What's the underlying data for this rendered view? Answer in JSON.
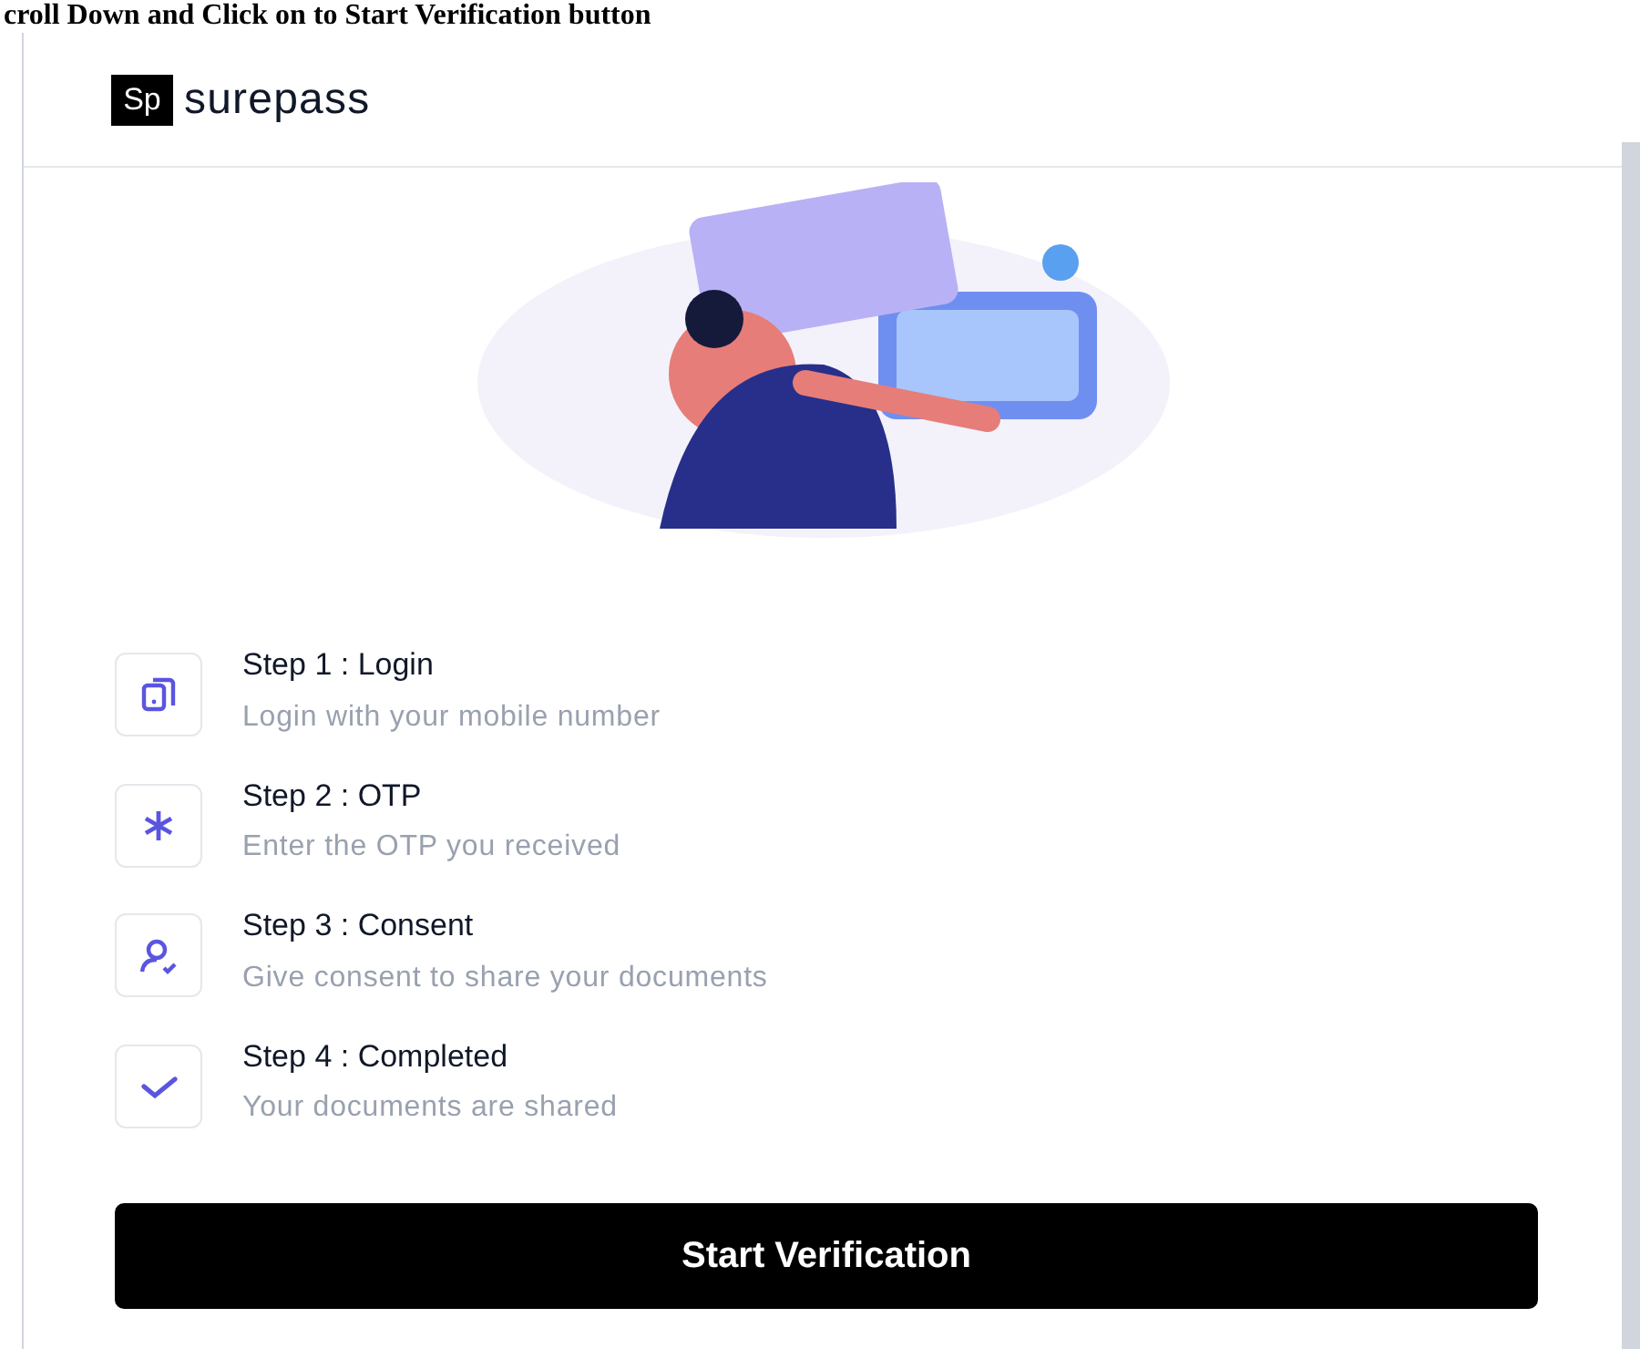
{
  "caption": "croll Down and Click on to Start Verification button",
  "brand": {
    "mark": "Sp",
    "name": "surepass"
  },
  "steps": [
    {
      "kind": "phone",
      "title": "Step 1 : Login",
      "description": "Login with your mobile number"
    },
    {
      "kind": "asterisk",
      "title": "Step 2 : OTP",
      "description": "Enter the OTP you received"
    },
    {
      "kind": "user",
      "title": "Step 3 : Consent",
      "description": "Give consent to share your documents"
    },
    {
      "kind": "check",
      "title": "Step 4 : Completed",
      "description": "Your documents are shared"
    }
  ],
  "button": "Start Verification"
}
